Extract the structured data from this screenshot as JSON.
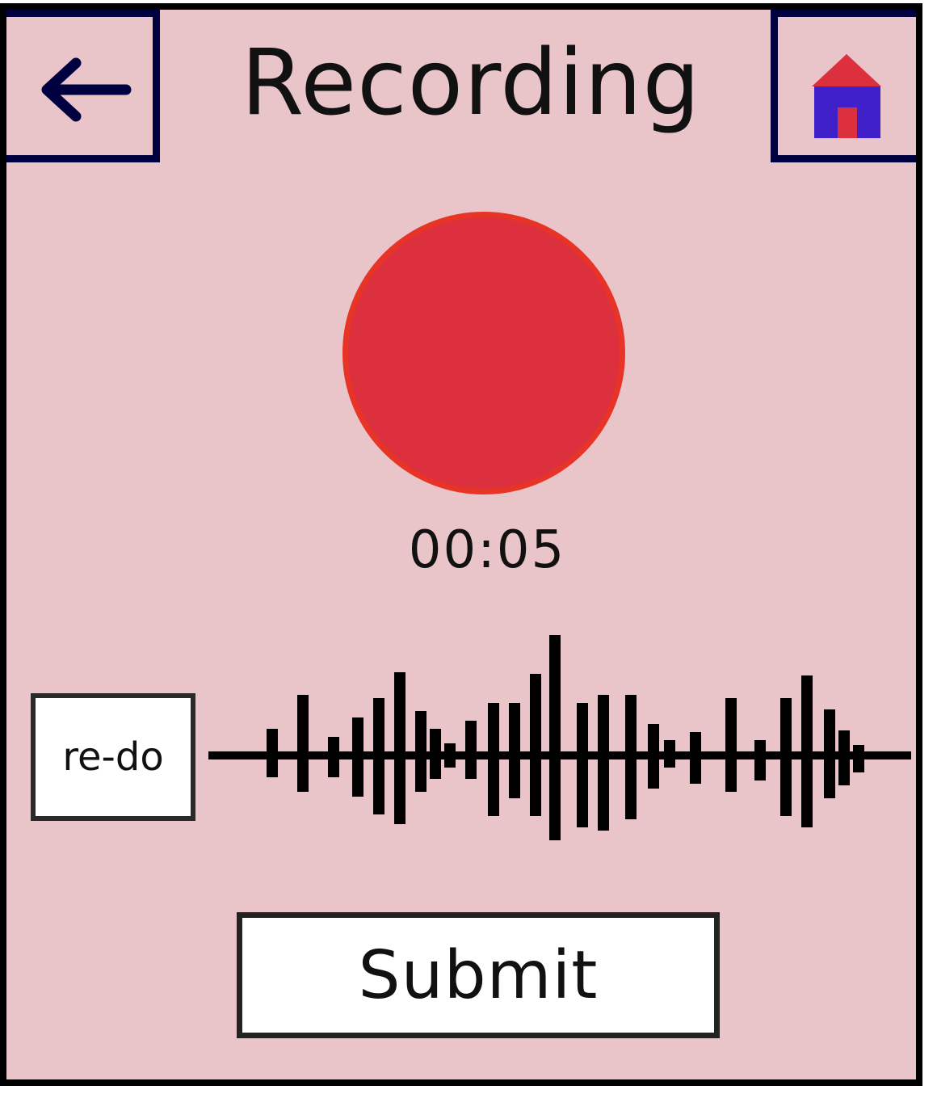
{
  "header": {
    "title": "Recording",
    "back_icon": "arrow-left-icon",
    "home_icon": "home-icon"
  },
  "recorder": {
    "record_icon": "record-circle-icon",
    "timer": "00:05"
  },
  "actions": {
    "redo_label": "re-do",
    "submit_label": "Submit"
  },
  "waveform": {
    "icon": "audio-waveform-icon"
  },
  "colors": {
    "background": "#e9c4c8",
    "record_fill": "#dc303f",
    "record_border": "#e83427",
    "nav_border": "#000040",
    "home_wall": "#4020c8",
    "home_roof": "#dc303f"
  }
}
